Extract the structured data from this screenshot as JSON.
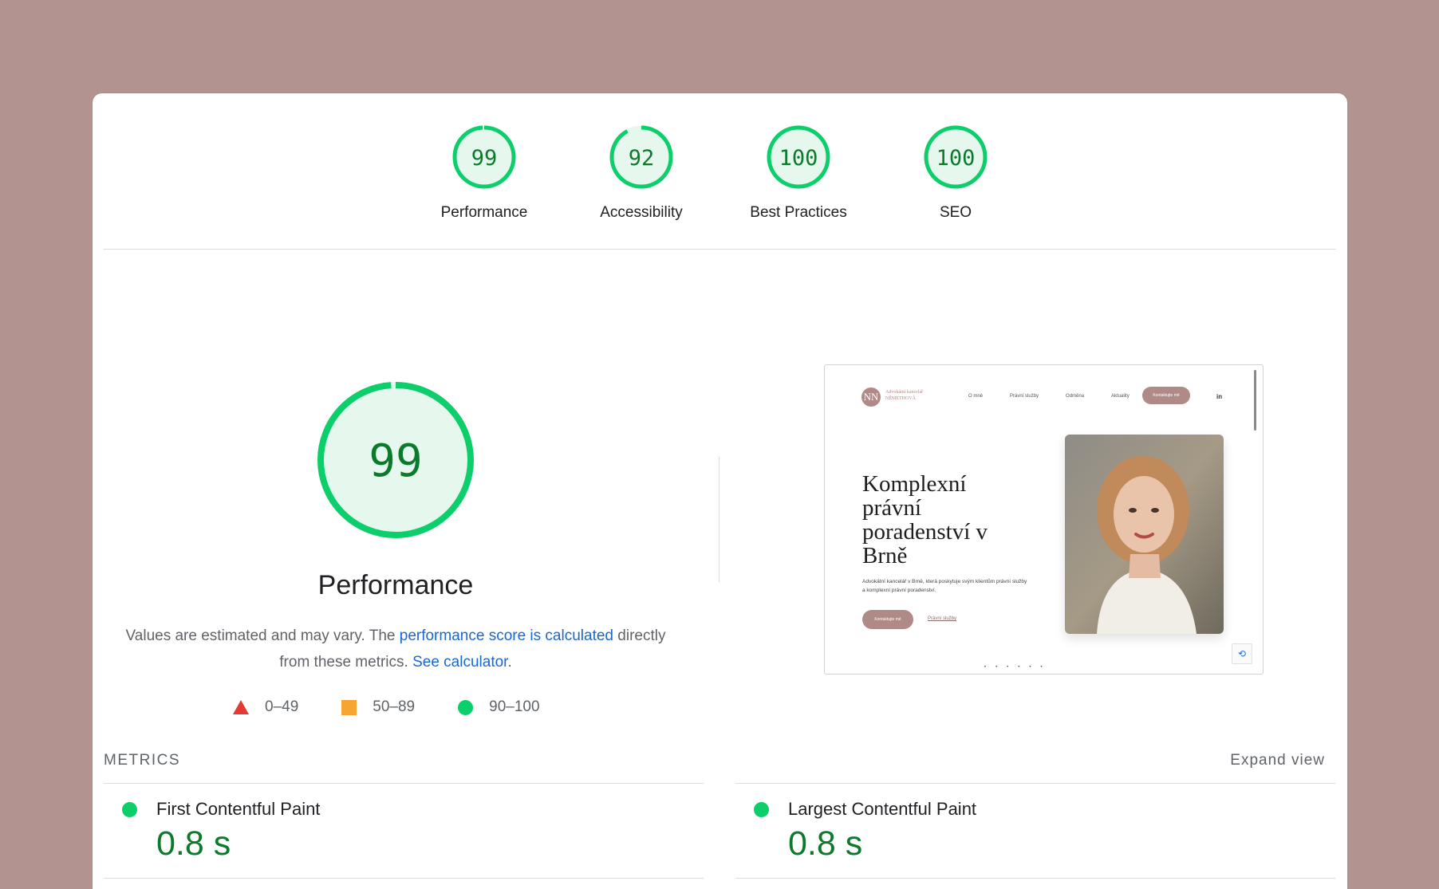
{
  "scores": [
    {
      "label": "Performance",
      "value": "99",
      "fraction": 0.99
    },
    {
      "label": "Accessibility",
      "value": "92",
      "fraction": 0.92
    },
    {
      "label": "Best Practices",
      "value": "100",
      "fraction": 1.0
    },
    {
      "label": "SEO",
      "value": "100",
      "fraction": 1.0
    }
  ],
  "performance": {
    "score": "99",
    "fraction": 0.99,
    "title": "Performance",
    "desc_prefix": "Values are estimated and may vary. The ",
    "desc_link1": "performance score is calculated",
    "desc_middle": " directly from these metrics. ",
    "desc_link2": "See calculator",
    "desc_suffix": "."
  },
  "legend": [
    {
      "icon": "triangle-fail-icon",
      "range": "0–49",
      "color": "#e53935"
    },
    {
      "icon": "square-average-icon",
      "range": "50–89",
      "color": "#f6a532"
    },
    {
      "icon": "circle-pass-icon",
      "range": "90–100",
      "color": "#0cce6b"
    }
  ],
  "screenshot": {
    "logo": "NN",
    "brand": "Advokátní kancelář NĚMETHOVÁ",
    "nav": [
      "O mně",
      "Právní služby",
      "Odměna",
      "Aktuality"
    ],
    "cta": "Kontaktujte mě",
    "social": "in",
    "heading": "Komplexní právní poradenství v Brně",
    "text": "Advokátní kancelář v Brně, která poskytuje svým klientům právní služby a komplexní právní poradenství.",
    "button": "Kontaktujte mě",
    "link": "Právní služby"
  },
  "metrics": {
    "section_label": "METRICS",
    "expand_label": "Expand view",
    "items": [
      {
        "name": "First Contentful Paint",
        "value": "0.8 s"
      },
      {
        "name": "Largest Contentful Paint",
        "value": "0.8 s"
      }
    ]
  },
  "colors": {
    "pass": "#0cce6b",
    "pass_text": "#0b7b2b",
    "pass_fill": "#e6f8ee",
    "link": "#1a67d2",
    "background": "#b39390"
  }
}
